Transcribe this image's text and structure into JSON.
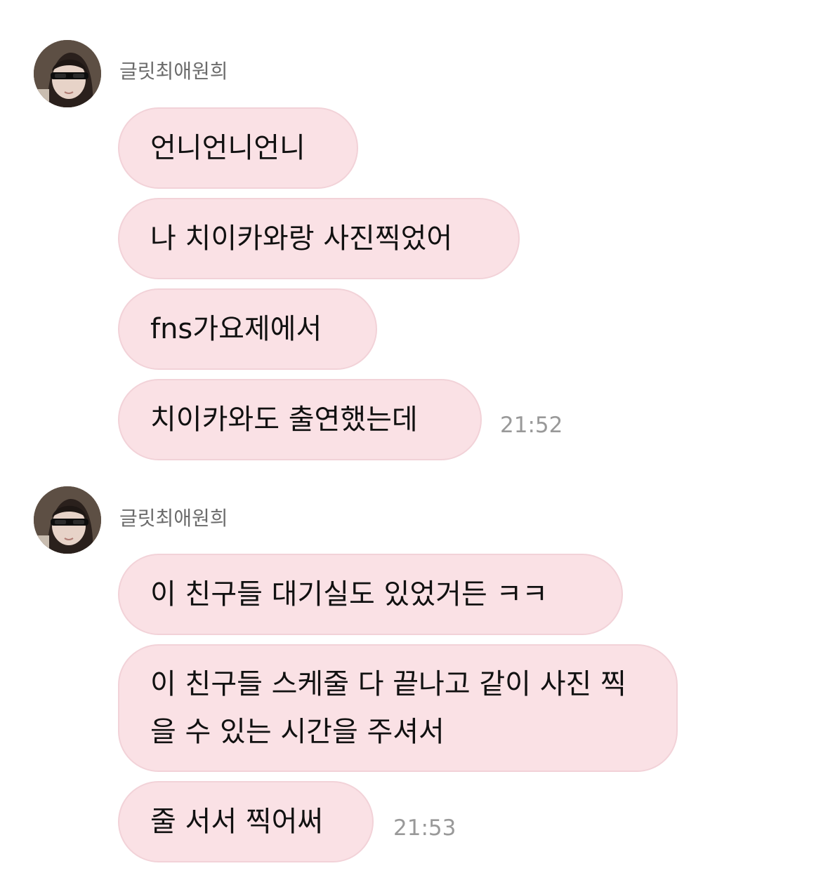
{
  "groups": [
    {
      "sender": "글릿최애원희",
      "avatar_icon": "profile-photo-sunglasses",
      "messages": [
        "언니언니언니",
        "나 치이카와랑 사진찍었어",
        "fns가요제에서",
        "치이카와도 출연했는데"
      ],
      "time": "21:52"
    },
    {
      "sender": "글릿최애원희",
      "avatar_icon": "profile-photo-sunglasses",
      "messages": [
        "이 친구들 대기실도 있었거든 ㅋㅋ",
        "이 친구들 스케줄 다 끝나고 같이 사진 찍을 수 있는 시간을 주셔서",
        "줄 서서 찍어써"
      ],
      "time": "21:53"
    }
  ],
  "colors": {
    "bubble_bg": "#fae1e5",
    "bubble_border": "#f2d2d8",
    "sender_text": "#6b6b6b",
    "time_text": "#999999"
  }
}
